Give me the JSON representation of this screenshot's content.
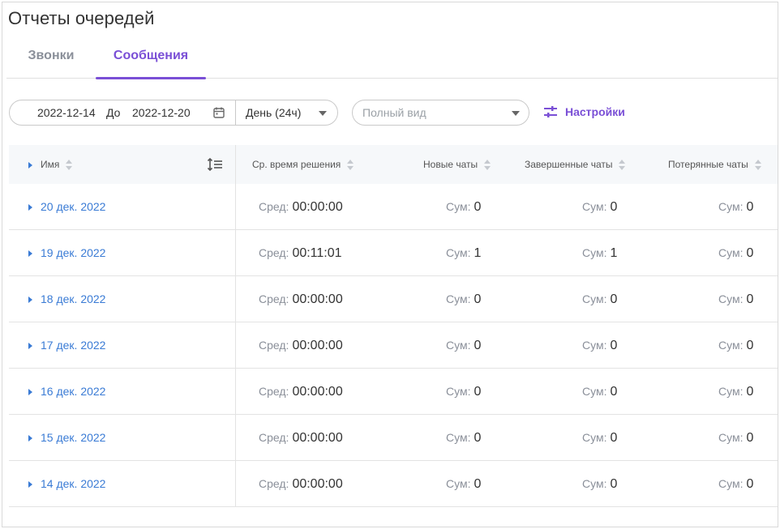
{
  "page": {
    "title": "Отчеты очередей"
  },
  "tabs": [
    {
      "label": "Звонки",
      "active": false
    },
    {
      "label": "Сообщения",
      "active": true
    }
  ],
  "filters": {
    "date_from": "2022-12-14",
    "to_label": "До",
    "date_to": "2022-12-20",
    "period": "День (24ч)",
    "view_placeholder": "Полный вид",
    "settings_label": "Настройки"
  },
  "table": {
    "headers": {
      "name": "Имя",
      "avg": "Ср. время решения",
      "new": "Новые чаты",
      "done": "Завершенные чаты",
      "lost": "Потерянные чаты"
    },
    "avg_prefix": "Сред:",
    "sum_prefix": "Сум:",
    "rows": [
      {
        "date": "20 дек. 2022",
        "avg": "00:00:00",
        "new": "0",
        "done": "0",
        "lost": "0"
      },
      {
        "date": "19 дек. 2022",
        "avg": "00:11:01",
        "new": "1",
        "done": "1",
        "lost": "0"
      },
      {
        "date": "18 дек. 2022",
        "avg": "00:00:00",
        "new": "0",
        "done": "0",
        "lost": "0"
      },
      {
        "date": "17 дек. 2022",
        "avg": "00:00:00",
        "new": "0",
        "done": "0",
        "lost": "0"
      },
      {
        "date": "16 дек. 2022",
        "avg": "00:00:00",
        "new": "0",
        "done": "0",
        "lost": "0"
      },
      {
        "date": "15 дек. 2022",
        "avg": "00:00:00",
        "new": "0",
        "done": "0",
        "lost": "0"
      },
      {
        "date": "14 дек. 2022",
        "avg": "00:00:00",
        "new": "0",
        "done": "0",
        "lost": "0"
      }
    ]
  },
  "colors": {
    "accent": "#7a4fd6",
    "link": "#3a7bd5",
    "header_bg": "#f6f8fa"
  }
}
